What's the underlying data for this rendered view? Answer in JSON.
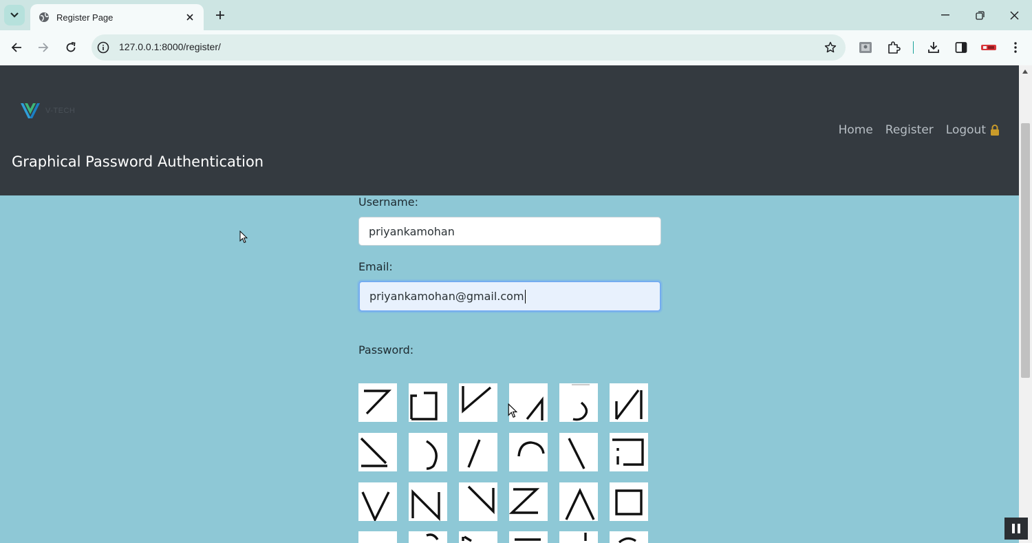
{
  "browser": {
    "tab_title": "Register Page",
    "url": "127.0.0.1:8000/register/"
  },
  "header": {
    "logo_text": "V-TECH",
    "title": "Graphical Password Authentication",
    "nav": {
      "home": "Home",
      "register": "Register",
      "logout": "Logout"
    }
  },
  "form": {
    "username_label": "Username:",
    "username_value": "priyankamohan",
    "email_label": "Email:",
    "email_value": "priyankamohan@gmail.com",
    "password_label": "Password:"
  },
  "password_tiles": [
    [
      "seven",
      "bracket-square",
      "check-v",
      "slash-angle",
      "hook",
      "n-reverse"
    ],
    [
      "z-triangle",
      "paren-right",
      "slash",
      "arch",
      "backslash",
      "bracket-open"
    ],
    [
      "v",
      "n",
      "check-reverse",
      "z",
      "lambda",
      "square"
    ],
    [
      "partial-1",
      "partial-2",
      "partial-3",
      "partial-4",
      "partial-5",
      "partial-6"
    ]
  ],
  "colors": {
    "header_bg": "#343a40",
    "page_bg": "#8ec8d6",
    "focus_border": "#74acf0",
    "lock": "#c99b2a"
  }
}
